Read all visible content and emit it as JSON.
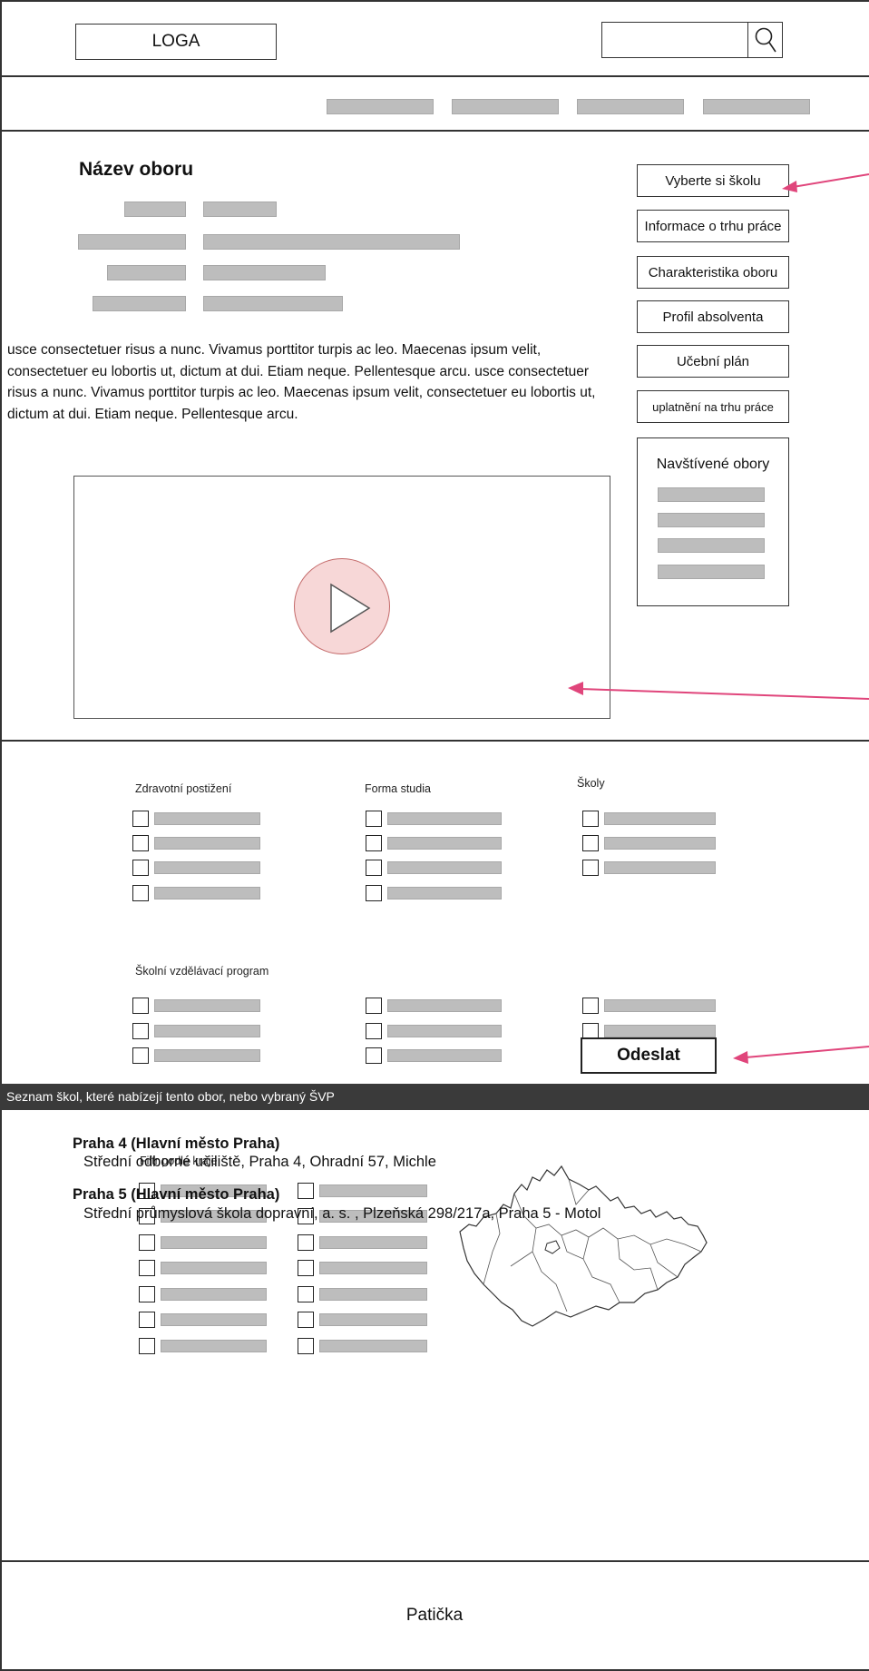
{
  "header": {
    "logo": "LOGA",
    "search": {
      "placeholder": "",
      "icon": "search-icon"
    }
  },
  "main": {
    "title": "Název oboru",
    "description": "usce consectetuer risus a nunc. Vivamus porttitor turpis ac leo. Maecenas ipsum velit, consectetuer eu lobortis ut, dictum at dui. Etiam neque. Pellentesque arcu. usce consectetuer risus a nunc. Vivamus porttitor turpis ac leo. Maecenas ipsum velit, consectetuer eu lobortis ut, dictum at dui. Etiam neque. Pellentesque arcu.",
    "video": {
      "icon": "play-icon"
    }
  },
  "sidebar": {
    "buttons": [
      "Vyberte si školu",
      "Informace o trhu práce",
      "Charakteristika oboru",
      "Profil absolventa",
      "Učební plán",
      "uplatnění na trhu práce"
    ],
    "visited_title": "Navštívené obory"
  },
  "filters": {
    "zdravotni": "Zdravotní postižení",
    "forma": "Forma studia",
    "skoly": "Školy",
    "svp": "Školní vzdělávací program",
    "kraj": "Filtr podle kraje",
    "submit": "Odeslat"
  },
  "list": {
    "header": "Seznam škol, které nabízejí tento obor, nebo vybraný ŠVP",
    "schools": [
      {
        "region": "Praha 4 (Hlavní město Praha)",
        "name": "Střední odborné učiliště, Praha 4, Ohradní 57, Michle"
      },
      {
        "region": "Praha 5 (Hlavní město Praha)",
        "name": "Střední průmyslová škola dopravní, a. s. , Plzeňská 298/217a, Praha 5 - Motol"
      }
    ]
  },
  "footer": {
    "text": "Patička"
  },
  "colors": {
    "accent_arrow": "#e0457b",
    "placeholder_bar": "#bdbdbd",
    "list_header_bg": "#3a3a3a"
  }
}
